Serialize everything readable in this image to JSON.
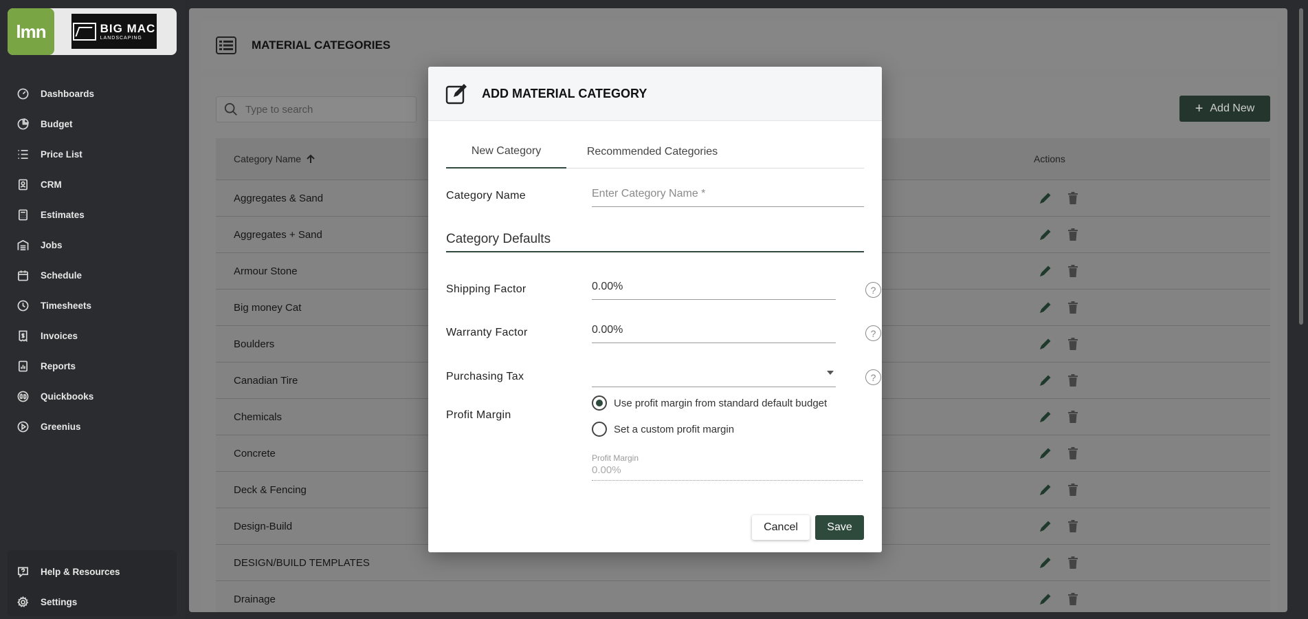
{
  "brand": {
    "app_logo": "lmn",
    "company_line1": "BIG MAC",
    "company_line2": "LANDSCAPING"
  },
  "sidebar": {
    "items": [
      {
        "label": "Dashboards",
        "icon": "speedometer-icon"
      },
      {
        "label": "Budget",
        "icon": "pie-chart-icon"
      },
      {
        "label": "Price List",
        "icon": "list-icon"
      },
      {
        "label": "CRM",
        "icon": "contacts-icon"
      },
      {
        "label": "Estimates",
        "icon": "calculator-icon"
      },
      {
        "label": "Jobs",
        "icon": "warehouse-icon"
      },
      {
        "label": "Schedule",
        "icon": "calendar-icon"
      },
      {
        "label": "Timesheets",
        "icon": "clock-icon"
      },
      {
        "label": "Invoices",
        "icon": "invoice-icon"
      },
      {
        "label": "Reports",
        "icon": "report-icon"
      },
      {
        "label": "Quickbooks",
        "icon": "quickbooks-icon"
      },
      {
        "label": "Greenius",
        "icon": "play-circle-icon"
      }
    ],
    "bottom": [
      {
        "label": "Help & Resources",
        "icon": "help-icon"
      },
      {
        "label": "Settings",
        "icon": "gear-icon"
      }
    ]
  },
  "page": {
    "title": "MATERIAL CATEGORIES"
  },
  "search": {
    "placeholder": "Type to search"
  },
  "add_button": {
    "label": "Add New"
  },
  "table": {
    "col_name": "Category Name",
    "col_actions": "Actions",
    "rows": [
      "Aggregates & Sand",
      "Aggregates + Sand",
      "Armour Stone",
      "Big money Cat",
      "Boulders",
      "Canadian Tire",
      "Chemicals",
      "Concrete",
      "Deck & Fencing",
      "Design-Build",
      "DESIGN/BUILD TEMPLATES",
      "Drainage"
    ]
  },
  "modal": {
    "title": "ADD MATERIAL CATEGORY",
    "tabs": [
      "New Category",
      "Recommended Categories"
    ],
    "category_name_label": "Category Name",
    "category_name_placeholder": "Enter Category Name *",
    "defaults_title": "Category Defaults",
    "shipping_label": "Shipping Factor",
    "shipping_value": "0.00%",
    "warranty_label": "Warranty Factor",
    "warranty_value": "0.00%",
    "tax_label": "Purchasing Tax",
    "tax_value": "",
    "profit_label": "Profit Margin",
    "radio_default": "Use profit margin from standard default budget",
    "radio_custom": "Set a custom profit margin",
    "pm_small_label": "Profit Margin",
    "pm_value": "0.00%",
    "help_glyph": "?",
    "cancel": "Cancel",
    "save": "Save"
  },
  "colors": {
    "accent": "#2e4a3c",
    "brand_green": "#79a544",
    "sidebar_bg": "#2b2c30"
  }
}
